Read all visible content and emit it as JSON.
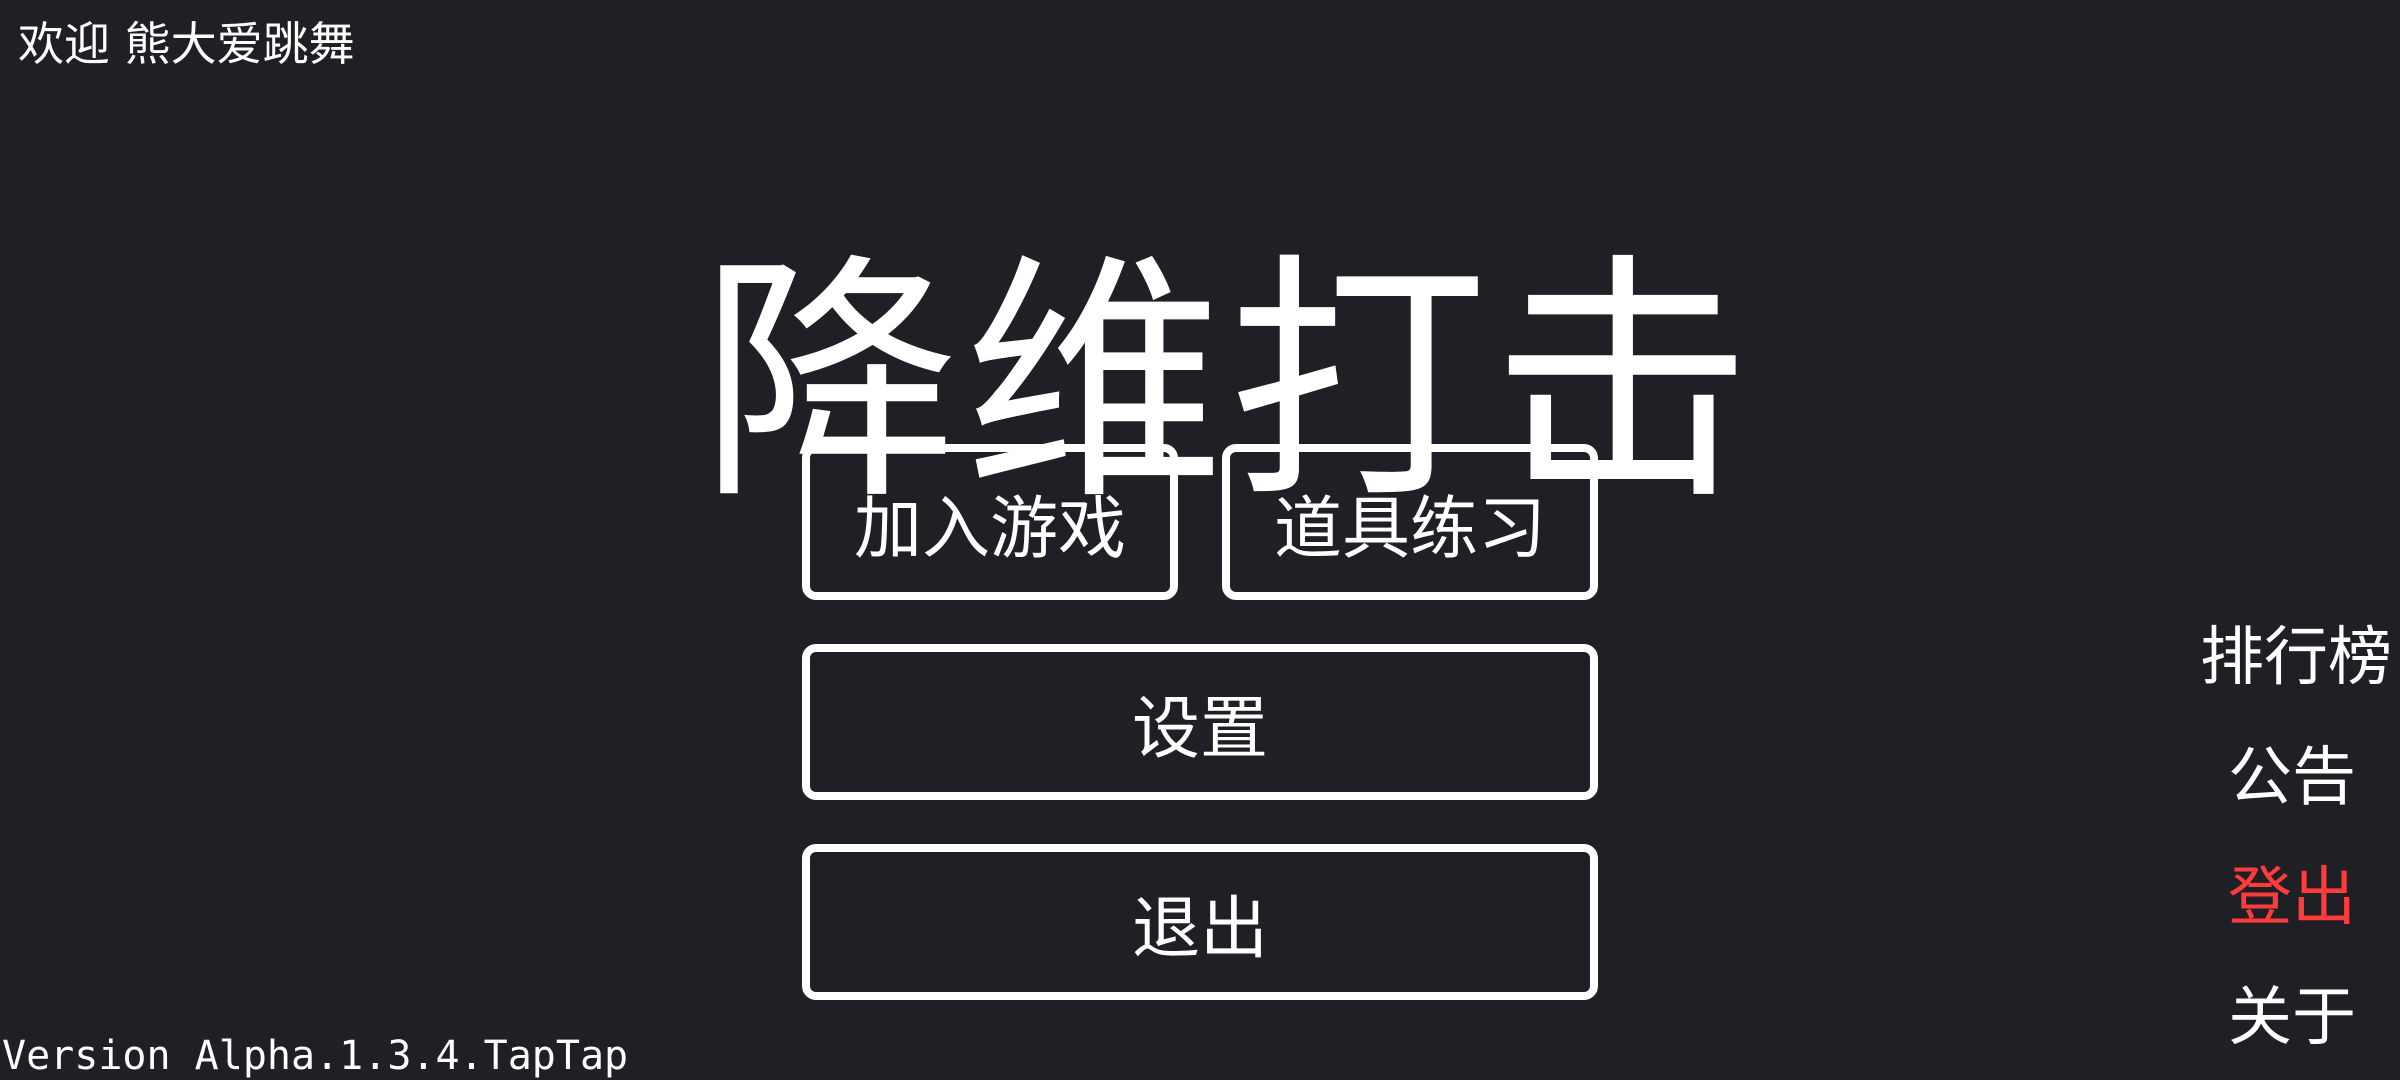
{
  "header": {
    "welcome_text": "欢迎 熊大爱跳舞"
  },
  "game": {
    "title": "降维打击"
  },
  "menu": {
    "join_game": "加入游戏",
    "item_practice": "道具练习",
    "settings": "设置",
    "exit": "退出"
  },
  "side_menu": {
    "leaderboard": "排行榜",
    "notice": "公告",
    "logout": "登出",
    "about": "关于"
  },
  "footer": {
    "version": "Version Alpha.1.3.4.TapTap"
  },
  "colors": {
    "background": "#1f2025",
    "foreground": "#ffffff",
    "logout": "#ff3b3b"
  }
}
